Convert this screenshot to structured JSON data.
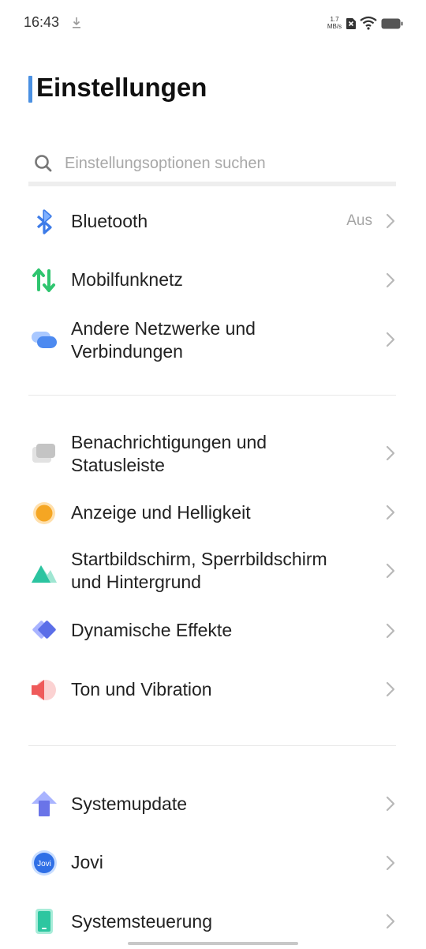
{
  "status_bar": {
    "time": "16:43",
    "net_speed_value": "1.7",
    "net_speed_unit": "MB/s",
    "icons": [
      "download-icon",
      "sim-icon",
      "wifi-icon",
      "battery-icon"
    ]
  },
  "title": "Einstellungen",
  "search": {
    "placeholder": "Einstellungsoptionen suchen"
  },
  "colors": {
    "accent": "#4a90e2",
    "bluetooth": "#3d7be8",
    "mobile": "#2fc56f",
    "network": "#4d8af0",
    "display": "#f5a623",
    "wallpaper": "#2bc4a0",
    "effects": "#5b6ee8",
    "sound": "#ef5a5a",
    "update": "#6a74e8",
    "control": "#2dc6a0"
  },
  "settings": {
    "bluetooth": {
      "label": "Bluetooth",
      "value": "Aus",
      "icon": "bluetooth-icon"
    },
    "mobile": {
      "label": "Mobilfunknetz",
      "icon": "mobile-network-icon"
    },
    "network": {
      "label_line1": "Andere Netzwerke und",
      "label_line2": "Verbindungen",
      "icon": "connections-icon"
    },
    "notifications": {
      "label_line1": "Benachrichtigungen und",
      "label_line2": "Statusleiste",
      "icon": "notifications-icon"
    },
    "display": {
      "label": "Anzeige und Helligkeit",
      "icon": "display-icon"
    },
    "homescreen": {
      "label_line1": "Startbildschirm, Sperrbildschirm",
      "label_line2": "und Hintergrund",
      "icon": "wallpaper-icon"
    },
    "effects": {
      "label": "Dynamische Effekte",
      "icon": "effects-icon"
    },
    "sound": {
      "label": "Ton und Vibration",
      "icon": "sound-icon"
    },
    "update": {
      "label": "Systemupdate",
      "icon": "update-icon"
    },
    "jovi": {
      "label": "Jovi",
      "icon_text": "Jovi",
      "icon": "jovi-icon"
    },
    "control": {
      "label": "Systemsteuerung",
      "icon": "system-control-icon"
    }
  }
}
